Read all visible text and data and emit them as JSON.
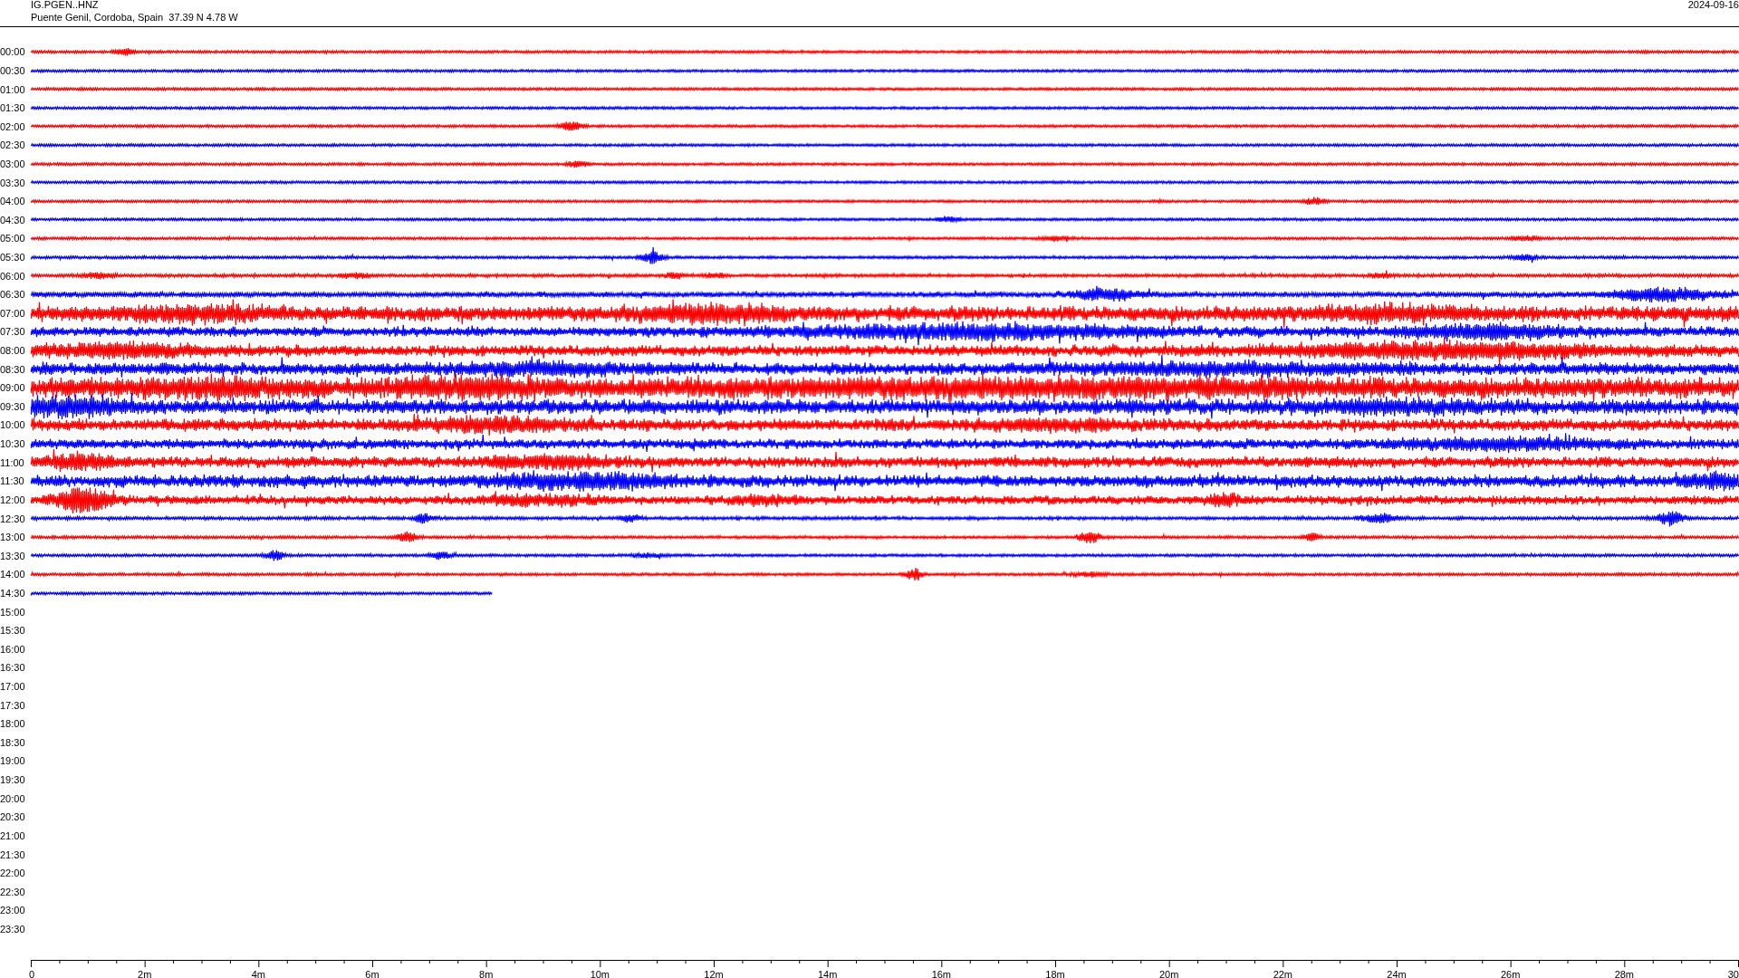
{
  "header": {
    "station": "IG.PGEN..HNZ",
    "location": "Puente Genil, Cordoba, Spain  37.39 N 4.78 W",
    "date": "2024-09-16"
  },
  "rows": [
    {
      "time": "00:00",
      "color": "#ff0000"
    },
    {
      "time": "00:30",
      "color": "#0000ff"
    },
    {
      "time": "01:00",
      "color": "#ff0000"
    },
    {
      "time": "01:30",
      "color": "#0000ff"
    },
    {
      "time": "02:00",
      "color": "#ff0000"
    },
    {
      "time": "02:30",
      "color": "#0000ff"
    },
    {
      "time": "03:00",
      "color": "#ff0000"
    },
    {
      "time": "03:30",
      "color": "#0000ff"
    },
    {
      "time": "04:00",
      "color": "#ff0000"
    },
    {
      "time": "04:30",
      "color": "#0000ff"
    },
    {
      "time": "05:00",
      "color": "#ff0000"
    },
    {
      "time": "05:30",
      "color": "#0000ff"
    },
    {
      "time": "06:00",
      "color": "#ff0000"
    },
    {
      "time": "06:30",
      "color": "#0000ff"
    },
    {
      "time": "07:00",
      "color": "#ff0000"
    },
    {
      "time": "07:30",
      "color": "#0000ff"
    },
    {
      "time": "08:00",
      "color": "#ff0000"
    },
    {
      "time": "08:30",
      "color": "#0000ff"
    },
    {
      "time": "09:00",
      "color": "#ff0000"
    },
    {
      "time": "09:30",
      "color": "#0000ff"
    },
    {
      "time": "10:00",
      "color": "#ff0000"
    },
    {
      "time": "10:30",
      "color": "#0000ff"
    },
    {
      "time": "11:00",
      "color": "#ff0000"
    },
    {
      "time": "11:30",
      "color": "#0000ff"
    },
    {
      "time": "12:00",
      "color": "#ff0000"
    },
    {
      "time": "12:30",
      "color": "#0000ff"
    },
    {
      "time": "13:00",
      "color": "#ff0000"
    },
    {
      "time": "13:30",
      "color": "#0000ff"
    },
    {
      "time": "14:00",
      "color": "#ff0000"
    },
    {
      "time": "14:30",
      "color": "#0000ff"
    },
    {
      "time": "15:00"
    },
    {
      "time": "15:30"
    },
    {
      "time": "16:00"
    },
    {
      "time": "16:30"
    },
    {
      "time": "17:00"
    },
    {
      "time": "17:30"
    },
    {
      "time": "18:00"
    },
    {
      "time": "18:30"
    },
    {
      "time": "19:00"
    },
    {
      "time": "19:30"
    },
    {
      "time": "20:00"
    },
    {
      "time": "20:30"
    },
    {
      "time": "21:00"
    },
    {
      "time": "21:30"
    },
    {
      "time": "22:00"
    },
    {
      "time": "22:30"
    },
    {
      "time": "23:00"
    },
    {
      "time": "23:30"
    }
  ],
  "axis": {
    "ticks": [
      "0",
      "2m",
      "4m",
      "6m",
      "8m",
      "10m",
      "12m",
      "14m",
      "16m",
      "18m",
      "20m",
      "22m",
      "24m",
      "26m",
      "28m",
      "30"
    ]
  }
}
